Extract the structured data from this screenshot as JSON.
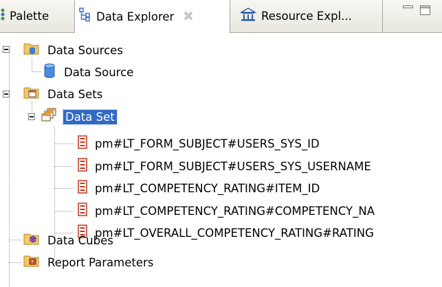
{
  "tabs": [
    {
      "label": "Palette",
      "icon": "palette-icon"
    },
    {
      "label": "Data Explorer",
      "icon": "data-explorer-icon",
      "active": true
    },
    {
      "label": "Resource Expl...",
      "icon": "resource-explorer-icon"
    }
  ],
  "tree": {
    "data_sources": "Data Sources",
    "data_source": "Data Source",
    "data_sets": "Data Sets",
    "data_set": "Data Set",
    "columns": [
      "pm#LT_FORM_SUBJECT#USERS_SYS_ID",
      "pm#LT_FORM_SUBJECT#USERS_SYS_USERNAME",
      "pm#LT_COMPETENCY_RATING#ITEM_ID",
      "pm#LT_COMPETENCY_RATING#COMPETENCY_NA",
      "pm#LT_OVERALL_COMPETENCY_RATING#RATING"
    ],
    "data_cubes": "Data Cubes",
    "report_parameters": "Report Parameters"
  },
  "colors": {
    "selection": "#316ac5",
    "folder": "#e8b24a",
    "column_icon": "#c4361c"
  }
}
